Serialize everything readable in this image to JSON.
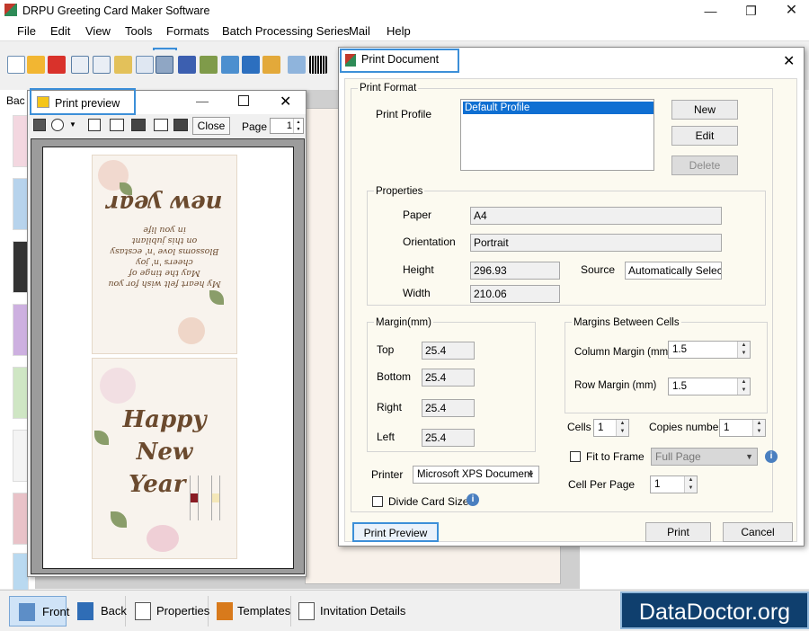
{
  "main": {
    "title": "DRPU Greeting Card Maker Software",
    "menu": [
      "File",
      "Edit",
      "View",
      "Tools",
      "Formats",
      "Batch Processing Series",
      "Mail",
      "Help"
    ],
    "left_strip_label": "Bac",
    "bottom_tabs": [
      {
        "label": "Front",
        "icon": "card-front-icon"
      },
      {
        "label": "Back",
        "icon": "card-back-icon"
      },
      {
        "label": "Properties",
        "icon": "properties-icon"
      },
      {
        "label": "Templates",
        "icon": "templates-icon"
      },
      {
        "label": "Invitation Details",
        "icon": "invitation-details-icon"
      }
    ],
    "brand": "DataDoctor.org"
  },
  "print_preview": {
    "title": "Print preview",
    "close_label": "Close",
    "page_label": "Page",
    "page_value": "1",
    "card": {
      "top_heading": "new year",
      "top_lines": [
        "My heart felt wish for you",
        "May the tinge of",
        "cheers 'n' joy",
        "Blossoms love 'n' ecstasy",
        "on this jubilant",
        "in you life"
      ],
      "bottom_lines": [
        "Happy",
        "New",
        "Year"
      ]
    }
  },
  "print_document": {
    "title": "Print Document",
    "print_format_label": "Print Format",
    "print_profile_label": "Print Profile",
    "profiles": [
      "Default Profile"
    ],
    "new_label": "New",
    "edit_label": "Edit",
    "delete_label": "Delete",
    "properties_label": "Properties",
    "paper_label": "Paper",
    "paper_value": "A4",
    "orientation_label": "Orientation",
    "orientation_value": "Portrait",
    "height_label": "Height",
    "height_value": "296.93",
    "width_label": "Width",
    "width_value": "210.06",
    "source_label": "Source",
    "source_value": "Automatically Selec",
    "margin_label": "Margin(mm)",
    "top_label": "Top",
    "top_value": "25.4",
    "bottom_label": "Bottom",
    "bottom_value": "25.4",
    "right_label": "Right",
    "right_value": "25.4",
    "left_label": "Left",
    "left_value": "25.4",
    "margins_between_label": "Margins Between Cells",
    "column_margin_label": "Column Margin (mm)",
    "column_margin_value": "1.5",
    "row_margin_label": "Row Margin (mm)",
    "row_margin_value": "1.5",
    "cells_label": "Cells",
    "cells_value": "1",
    "copies_label": "Copies number",
    "copies_value": "1",
    "fit_to_frame_label": "Fit to Frame",
    "fit_to_frame_value": "Full Page",
    "cell_per_page_label": "Cell Per Page",
    "cell_per_page_value": "1",
    "printer_label": "Printer",
    "printer_value": "Microsoft XPS Document",
    "divide_card_label": "Divide Card Size",
    "print_preview_label": "Print Preview",
    "print_label": "Print",
    "cancel_label": "Cancel"
  }
}
